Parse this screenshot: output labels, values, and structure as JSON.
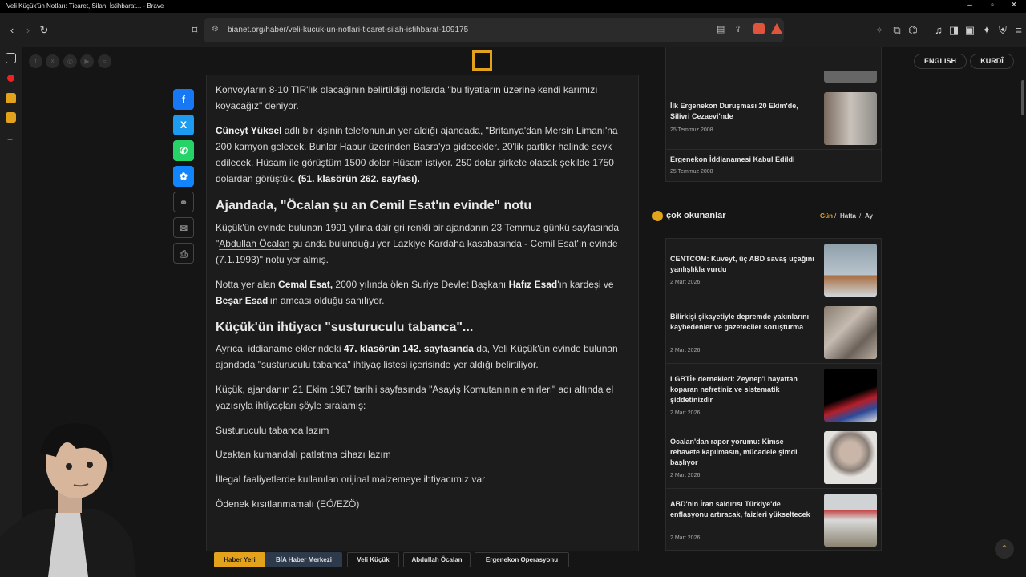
{
  "window": {
    "title": "Veli Küçük'ün Notları: Ticaret, Silah, İstihbarat... - Brave"
  },
  "browser": {
    "url": "bianet.org/haber/veli-kucuk-un-notlari-ticaret-silah-istihbarat-109175"
  },
  "header": {
    "lang_english": "ENGLISH",
    "lang_kurdi": "KURDÎ"
  },
  "share": [
    "facebook-icon",
    "x-icon",
    "whatsapp-icon",
    "bluesky-icon",
    "link-icon",
    "mail-icon",
    "print-icon"
  ],
  "article": {
    "p1": "Konvoyların 8-10 TIR'lık olacağının belirtildiği notlarda \"bu fiyatların üzerine kendi karımızı koyacağız\" deniyor.",
    "p2_name": "Cüneyt Yüksel",
    "p2_text": " adlı bir kişinin telefonunun yer aldığı ajandada, \"Britanya'dan Mersin Limanı'na 200 kamyon gelecek. Bunlar Habur üzerinden Basra'ya gidecekler. 20'lik partiler halinde sevk edilecek. Hüsam ile görüştüm 1500 dolar Hüsam istiyor. 250 dolar şirkete olacak şekilde 1750 dolardan görüştük. ",
    "p2_ref": "(51. klasörün 262. sayfası).",
    "h1": "Ajandada, \"Öcalan şu an Cemil Esat'ın evinde\" notu",
    "p3_a": "Küçük'ün evinde bulunan 1991 yılına dair gri renkli bir ajandanın 23 Temmuz günkü sayfasında \"",
    "p3_link": "Abdullah Öcalan",
    "p3_b": " şu anda bulunduğu yer Lazkiye Kardaha kasabasında - Cemil Esat'ın evinde (7.1.1993)\" notu yer almış.",
    "p4_a": "Notta yer alan ",
    "p4_name1": "Cemal Esat,",
    "p4_b": " 2000 yılında ölen Suriye Devlet Başkanı ",
    "p4_name2": "Hafız Esad",
    "p4_c": "'ın kardeşi ve ",
    "p4_name3": "Beşar Esad",
    "p4_d": "'ın amcası olduğu sanılıyor.",
    "h2": "Küçük'ün ihtiyacı \"susturuculu tabanca\"...",
    "p5_a": "Ayrıca, iddianame eklerindeki ",
    "p5_ref": "47. klasörün 142. sayfasında",
    "p5_b": " da, Veli Küçük'ün evinde bulunan ajandada \"susturuculu tabanca\" ihtiyaç listesi içerisinde yer aldığı belirtiliyor.",
    "p6": "Küçük, ajandanın 21 Ekim 1987 tarihli sayfasında \"Asayiş Komutanının emirleri\" adı altında el yazısıyla ihtiyaçları şöyle sıralamış:",
    "list": [
      "Susturuculu tabanca lazım",
      "Uzaktan kumandalı patlatma cihazı lazım",
      "İllegal faaliyetlerde kullanılan orijinal malzemeye ihtiyacımız var",
      "Ödenek kısıtlanmamalı (EÖ/EZÖ)"
    ],
    "tags": [
      "Haber Yeri",
      "BİA Haber Merkezi",
      "Veli Küçük",
      "Abdullah Öcalan",
      "Ergenekon Operasyonu"
    ]
  },
  "related": [
    {
      "title": "İlk Ergenekon Duruşması 20 Ekim'de, Silivri Cezaevi'nde",
      "date": "25 Temmuz 2008"
    },
    {
      "title": "Ergenekon İddianamesi Kabul Edildi",
      "date": "25 Temmuz 2008"
    }
  ],
  "most_read": {
    "title": "çok okunanlar",
    "filter_day": "Gün",
    "filter_week": "Hafta",
    "filter_month": "Ay",
    "sep": "/",
    "items": [
      {
        "title": "CENTCOM: Kuveyt, üç ABD savaş uçağını yanlışlıkla vurdu",
        "date": "2 Mart 2026"
      },
      {
        "title": "Bilirkişi şikayetiyle depremde yakınlarını kaybedenler ve gazeteciler soruşturma",
        "date": "2 Mart 2026"
      },
      {
        "title": "LGBTİ+ dernekleri: Zeynep'i hayattan koparan nefretiniz ve sistematik şiddetinizdir",
        "date": "2 Mart 2026"
      },
      {
        "title": "Öcalan'dan rapor yorumu: Kimse rehavete kapılmasın, mücadele şimdi başlıyor",
        "date": "2 Mart 2026"
      },
      {
        "title": "ABD'nin İran saldırısı Türkiye'de enflasyonu artıracak, faizleri yükseltecek",
        "date": "2 Mart 2026"
      }
    ]
  },
  "colors": {
    "accent": "#e2a21b",
    "bg": "#151515",
    "panel": "#1c1c1c"
  }
}
